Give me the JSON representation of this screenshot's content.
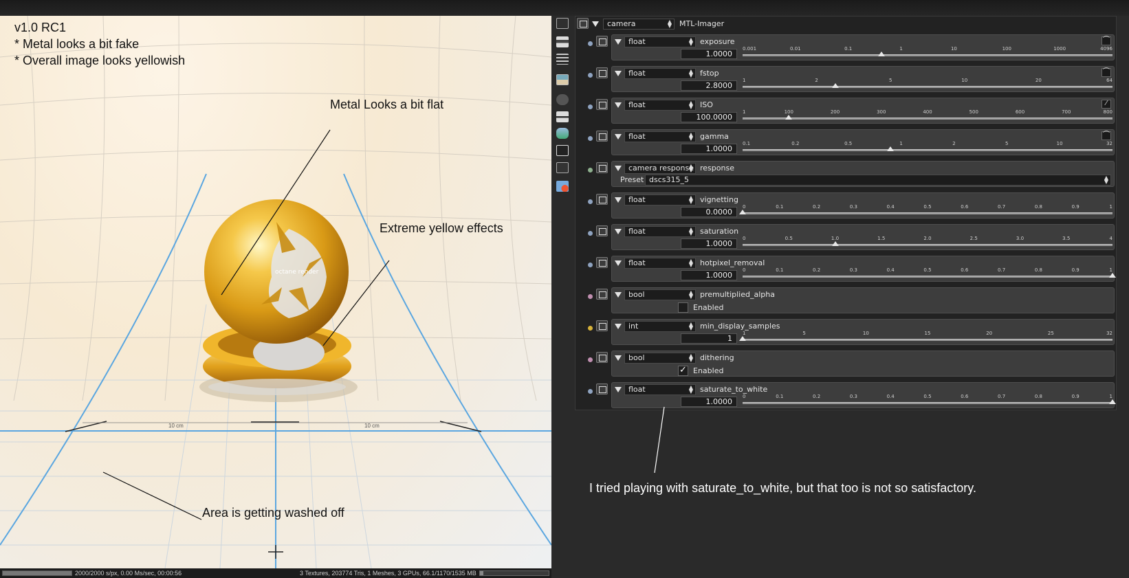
{
  "viewport": {
    "notes": [
      "v1.0 RC1",
      "* Metal looks a bit fake",
      "* Overall image looks yellowish"
    ],
    "callouts": {
      "metal_flat": "Metal Looks a bit flat",
      "yellow": "Extreme yellow effects",
      "washed": "Area is getting washed off"
    },
    "ruler_labels": [
      "10 cm",
      "10 cm"
    ],
    "logo_text": "octane render"
  },
  "statusbar": {
    "left": "2000/2000 s/px, 0.00 Ms/sec, 00:00:56",
    "right": "3 Textures, 203774 Tris, 1 Meshes, 3 GPUs, 66.1/1170/1535 MB"
  },
  "toolbar": {
    "icons": [
      "render-settings-icon",
      "layers-icon",
      "list-icon",
      "image-icon",
      "camera-icon",
      "strip-icon",
      "environment-icon",
      "imager-icon",
      "postprocess-icon",
      "material-icon"
    ]
  },
  "panel": {
    "header": {
      "type": "camera",
      "name": "MTL-Imager"
    },
    "preset_label": "Preset",
    "enabled_label": "Enabled",
    "params": [
      {
        "type": "float",
        "name": "exposure",
        "value": "1.0000",
        "ticks": [
          "0.001",
          "0.01",
          "0.1",
          "1",
          "10",
          "100",
          "1000",
          "4096"
        ],
        "thumb": 0.375,
        "bullet": "#8fa3c0",
        "curve": "log"
      },
      {
        "type": "float",
        "name": "fstop",
        "value": "2.8000",
        "ticks": [
          "1",
          "2",
          "5",
          "10",
          "20",
          "64"
        ],
        "thumb": 0.25,
        "bullet": "#8fa3c0",
        "curve": "log"
      },
      {
        "type": "float",
        "name": "ISO",
        "value": "100.0000",
        "ticks": [
          "1",
          "100",
          "200",
          "300",
          "400",
          "500",
          "600",
          "700",
          "800"
        ],
        "thumb": 0.124,
        "bullet": "#8fa3c0",
        "curve": "linear"
      },
      {
        "type": "float",
        "name": "gamma",
        "value": "1.0000",
        "ticks": [
          "0.1",
          "0.2",
          "0.5",
          "1",
          "2",
          "5",
          "10",
          "32"
        ],
        "thumb": 0.4,
        "bullet": "#8fa3c0",
        "curve": "log"
      },
      {
        "type": "camera response",
        "name": "response",
        "preset": "dscs315_5",
        "bullet": "#8eb08e"
      },
      {
        "type": "float",
        "name": "vignetting",
        "value": "0.0000",
        "ticks": [
          "0",
          "0.1",
          "0.2",
          "0.3",
          "0.4",
          "0.5",
          "0.6",
          "0.7",
          "0.8",
          "0.9",
          "1"
        ],
        "thumb": 0.0,
        "bullet": "#8fa3c0"
      },
      {
        "type": "float",
        "name": "saturation",
        "value": "1.0000",
        "ticks": [
          "0",
          "0.5",
          "1.0",
          "1.5",
          "2.0",
          "2.5",
          "3.0",
          "3.5",
          "4"
        ],
        "thumb": 0.25,
        "bullet": "#8fa3c0"
      },
      {
        "type": "float",
        "name": "hotpixel_removal",
        "value": "1.0000",
        "ticks": [
          "0",
          "0.1",
          "0.2",
          "0.3",
          "0.4",
          "0.5",
          "0.6",
          "0.7",
          "0.8",
          "0.9",
          "1"
        ],
        "thumb": 1.0,
        "bullet": "#8fa3c0"
      },
      {
        "type": "bool",
        "name": "premultiplied_alpha",
        "checked": false,
        "bullet": "#c08fb0"
      },
      {
        "type": "int",
        "name": "min_display_samples",
        "value": "1",
        "ticks": [
          "1",
          "5",
          "10",
          "15",
          "20",
          "25",
          "32"
        ],
        "thumb": 0.0,
        "bullet": "#d7b33a"
      },
      {
        "type": "bool",
        "name": "dithering",
        "checked": true,
        "bullet": "#c08fb0"
      },
      {
        "type": "float",
        "name": "saturate_to_white",
        "value": "1.0000",
        "ticks": [
          "0",
          "0.1",
          "0.2",
          "0.3",
          "0.4",
          "0.5",
          "0.6",
          "0.7",
          "0.8",
          "0.9",
          "1"
        ],
        "thumb": 1.0,
        "bullet": "#8fa3c0"
      }
    ]
  },
  "comment": "I tried playing with saturate_to_white, but that too is not so satisfactory."
}
